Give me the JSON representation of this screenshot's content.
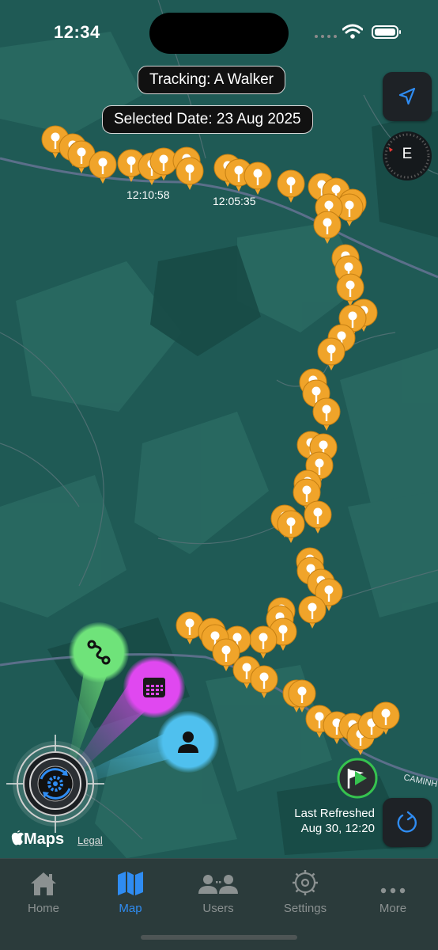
{
  "status_bar": {
    "time": "12:34"
  },
  "map": {
    "tracking_label": "Tracking: A Walker",
    "selected_date_label": "Selected Date: 23 Aug 2025",
    "timestamps": [
      "12:10:58",
      "12:05:35"
    ],
    "road_label": "CAMINH",
    "compass_heading": "E",
    "maps_brand": "Maps",
    "legal_label": "Legal",
    "last_refreshed_label": "Last Refreshed",
    "last_refreshed_value": "Aug 30, 12:20",
    "colors": {
      "pin": "#f0a42a",
      "map_land": "#1f5a55",
      "route": "#6fe37a",
      "calendar": "#e048f0",
      "user": "#4fc0ee",
      "accent": "#2f8cf2"
    }
  },
  "radial_menu": {
    "items": [
      {
        "name": "route-button",
        "icon": "route-icon"
      },
      {
        "name": "calendar-button",
        "icon": "calendar-icon"
      },
      {
        "name": "user-button",
        "icon": "person-icon"
      }
    ],
    "center_icon": "gear-icon"
  },
  "tab_bar": {
    "tabs": [
      {
        "label": "Home",
        "icon": "house-icon",
        "active": false
      },
      {
        "label": "Map",
        "icon": "map-icon",
        "active": true
      },
      {
        "label": "Users",
        "icon": "users-icon",
        "active": false
      },
      {
        "label": "Settings",
        "icon": "gear-icon",
        "active": false
      },
      {
        "label": "More",
        "icon": "ellipsis-icon",
        "active": false
      }
    ]
  }
}
